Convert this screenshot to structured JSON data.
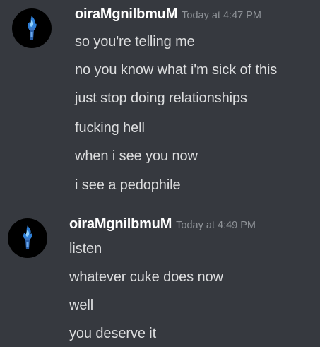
{
  "groups": [
    {
      "username": "oiraMgnilbmuM",
      "timestamp": "Today at 4:47 PM",
      "avatar_icon": "blue-flame-torch-icon",
      "lines": [
        "so you're telling me",
        "no you know what i'm sick of this",
        "just stop doing relationships",
        "fucking hell",
        "when i see you now",
        "i see a pedophile"
      ]
    },
    {
      "username": "oiraMgnilbmuM",
      "timestamp": "Today at 4:49 PM",
      "avatar_icon": "blue-flame-torch-icon",
      "lines": [
        "listen",
        "whatever cuke does now",
        "well",
        "you deserve it"
      ]
    }
  ],
  "colors": {
    "background": "#36393f",
    "username": "#ffffff",
    "timestamp": "#8e9297",
    "message_text": "#dcddde",
    "avatar_bg": "#000000",
    "flame_accent": "#3f8fe0"
  }
}
